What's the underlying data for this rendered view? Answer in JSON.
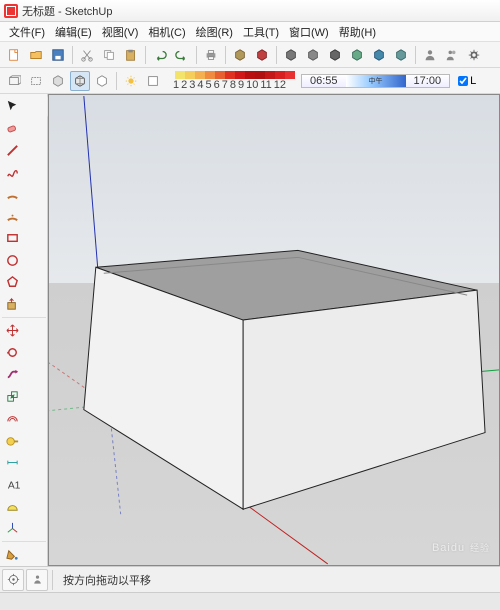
{
  "window": {
    "title": "无标题 - SketchUp"
  },
  "menu": {
    "file": "文件(F)",
    "edit": "编辑(E)",
    "view": "视图(V)",
    "camera": "相机(C)",
    "draw": "绘图(R)",
    "tools": "工具(T)",
    "window": "窗口(W)",
    "help": "帮助(H)"
  },
  "color_scale": {
    "labels": [
      "1",
      "2",
      "3",
      "4",
      "5",
      "6",
      "7",
      "8",
      "9",
      "10",
      "11",
      "12"
    ]
  },
  "time_scale": {
    "start": "06:55",
    "mid": "中午",
    "end": "17:00"
  },
  "toggle_layers_label": "L",
  "status": {
    "hint": "按方向拖动以平移"
  },
  "watermark": {
    "brand": "Baidu",
    "sub": "经验"
  }
}
